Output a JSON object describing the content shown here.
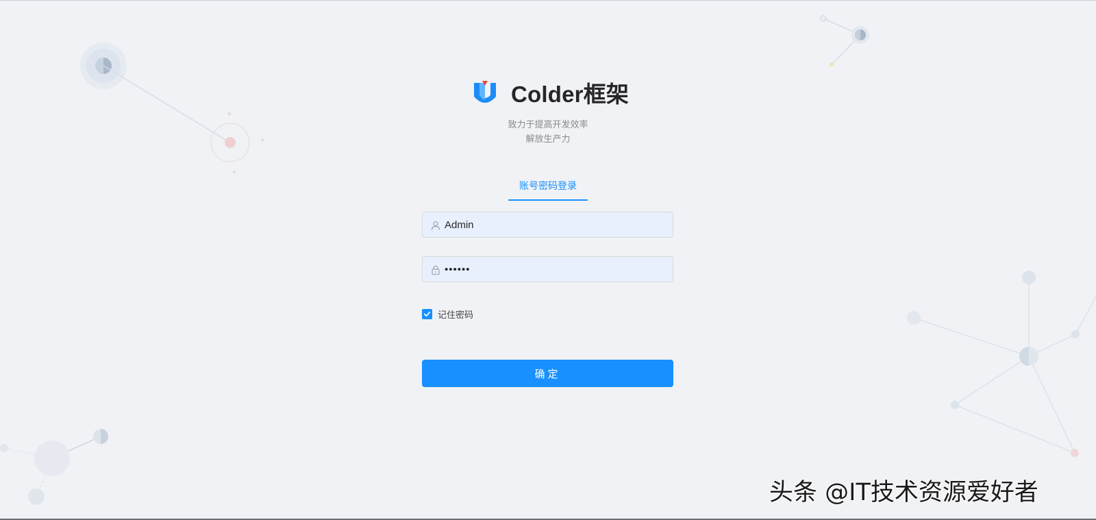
{
  "brand": {
    "title": "Colder框架",
    "logo_icon": "colder-logo-icon",
    "slogan_line1": "致力于提高开发效率",
    "slogan_line2": "解放生产力"
  },
  "login": {
    "tab_label": "账号密码登录",
    "username": {
      "value": "Admin",
      "icon": "user-icon"
    },
    "password": {
      "value": "••••••",
      "icon": "lock-icon"
    },
    "remember": {
      "label": "记住密码",
      "checked": true
    },
    "submit_label": "确定"
  },
  "watermark": "头条 @IT技术资源爱好者",
  "colors": {
    "background": "#f0f2f5",
    "primary": "#1890ff",
    "input_bg": "#e8f0fe"
  }
}
